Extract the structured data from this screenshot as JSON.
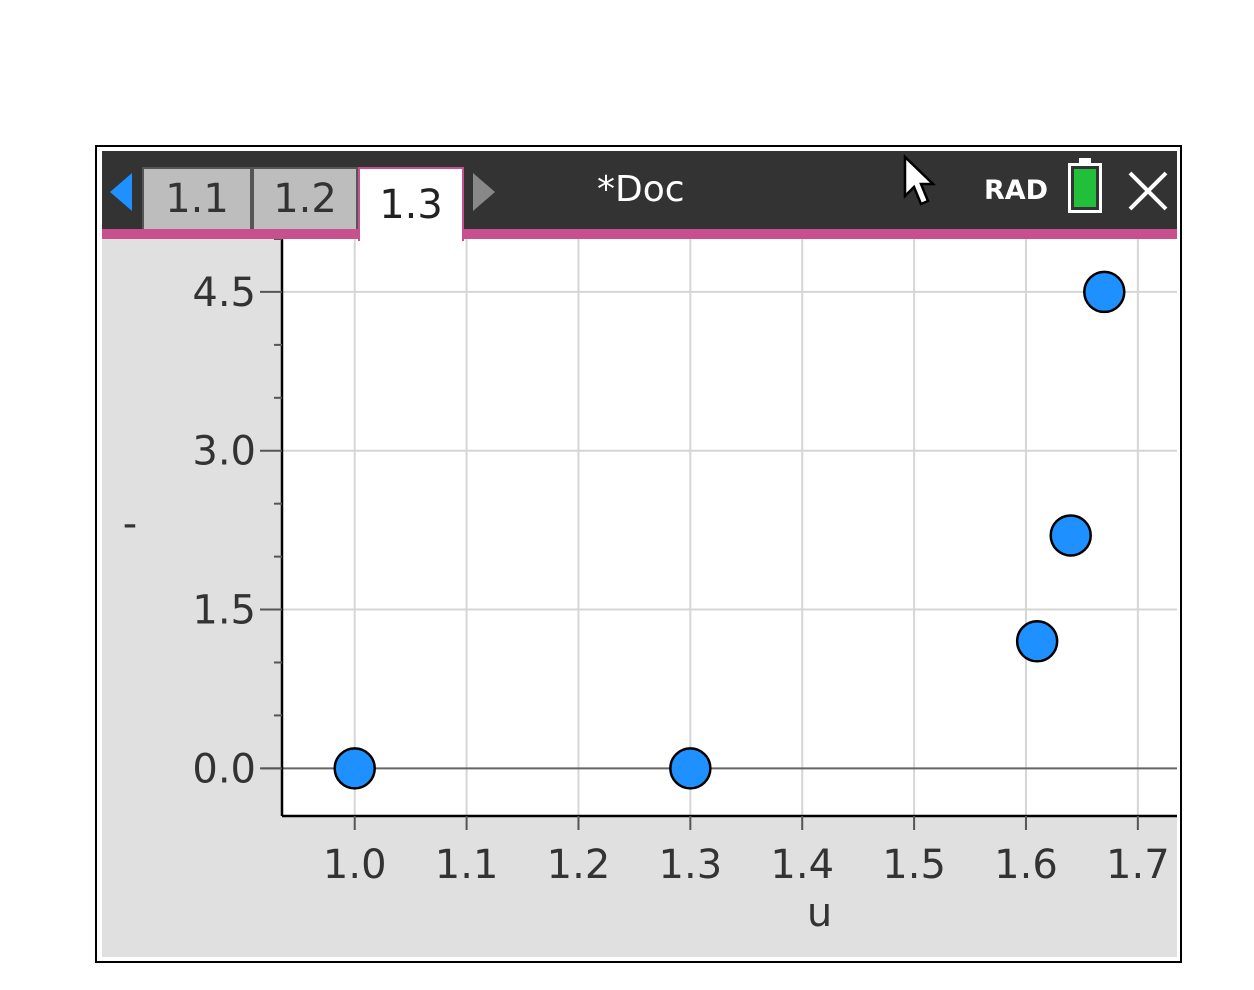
{
  "tabs": [
    {
      "label": "1.1",
      "active": false
    },
    {
      "label": "1.2",
      "active": false
    },
    {
      "label": "1.3",
      "active": true
    }
  ],
  "document_title": "*Doc",
  "angle_mode": "RAD",
  "icons": {
    "nav_left": "left-triangle-arrow",
    "nav_right": "right-triangle-arrow",
    "battery": "battery-icon",
    "close": "close-x-icon",
    "cursor": "mouse-pointer-icon"
  },
  "colors": {
    "titlebar": "#333333",
    "accent_pink": "#c8508f",
    "point_fill": "#1e90ff",
    "battery_fill": "#22c03a",
    "workspace": "#e0e0e0"
  },
  "chart_data": {
    "type": "scatter",
    "x": [
      1.0,
      1.3,
      1.61,
      1.64,
      1.67
    ],
    "y": [
      0.0,
      0.0,
      1.2,
      2.2,
      4.5
    ],
    "xlabel": "u",
    "ylabel": "-",
    "xlim": [
      0.935,
      1.735
    ],
    "ylim": [
      -0.45,
      5.0
    ],
    "x_ticks": [
      "1.0",
      "1.1",
      "1.2",
      "1.3",
      "1.4",
      "1.5",
      "1.6",
      "1.7"
    ],
    "x_tick_values": [
      1.0,
      1.1,
      1.2,
      1.3,
      1.4,
      1.5,
      1.6,
      1.7
    ],
    "y_ticks": [
      "0.0",
      "1.5",
      "3.0",
      "4.5"
    ],
    "y_tick_values": [
      0.0,
      1.5,
      3.0,
      4.5
    ],
    "y_minor_step": 0.5,
    "grid": true
  }
}
